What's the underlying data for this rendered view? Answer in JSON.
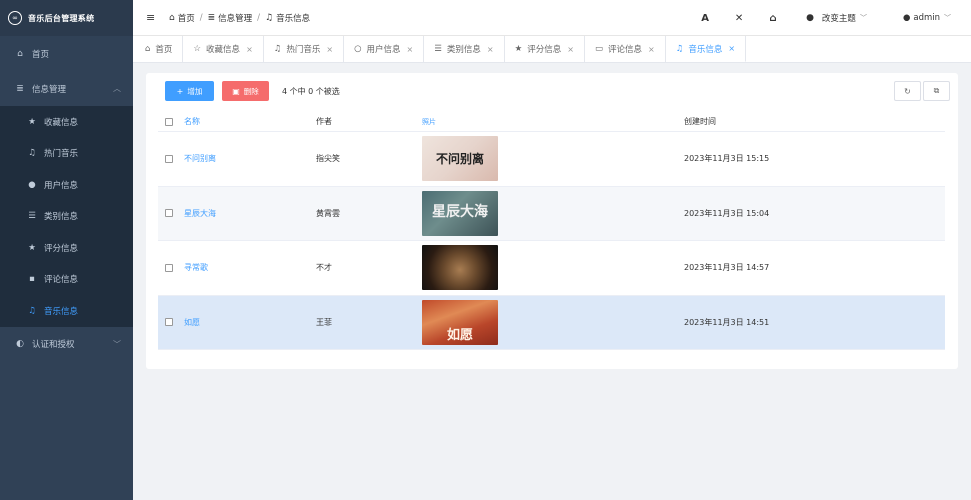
{
  "app": {
    "title": "音乐后台管理系统",
    "logo_icon": "∞"
  },
  "sidebar": {
    "home": {
      "label": "首页",
      "icon": "home-icon"
    },
    "info_mgmt": {
      "label": "信息管理",
      "icon": "database-icon"
    },
    "sub_items": [
      {
        "label": "收藏信息",
        "icon": "star-icon"
      },
      {
        "label": "热门音乐",
        "icon": "music-icon"
      },
      {
        "label": "用户信息",
        "icon": "user-icon"
      },
      {
        "label": "类别信息",
        "icon": "list-icon"
      },
      {
        "label": "评分信息",
        "icon": "star-icon"
      },
      {
        "label": "评论信息",
        "icon": "comments-icon"
      },
      {
        "label": "音乐信息",
        "icon": "music-icon",
        "active": true
      }
    ],
    "auth": {
      "label": "认证和授权",
      "icon": "shield-icon"
    }
  },
  "header": {
    "breadcrumb": [
      "首页",
      "信息管理",
      "音乐信息"
    ],
    "theme_label": "改变主题",
    "user_label": "admin"
  },
  "tabs": [
    {
      "label": "首页",
      "closable": false
    },
    {
      "label": "收藏信息",
      "closable": true
    },
    {
      "label": "热门音乐",
      "closable": true
    },
    {
      "label": "用户信息",
      "closable": true
    },
    {
      "label": "类别信息",
      "closable": true
    },
    {
      "label": "评分信息",
      "closable": true
    },
    {
      "label": "评论信息",
      "closable": true
    },
    {
      "label": "音乐信息",
      "closable": true,
      "active": true
    }
  ],
  "toolbar": {
    "add_label": "增加",
    "delete_label": "删除",
    "selection_info": "4 个中 0 个被选"
  },
  "table": {
    "columns": [
      "名称",
      "作者",
      "照片",
      "创建时间"
    ],
    "rows": [
      {
        "name": "不问别离",
        "author": "指尖笑",
        "thumb_text": "不问别离",
        "created": "2023年11月3日 15:15"
      },
      {
        "name": "星辰大海",
        "author": "黄霄雲",
        "thumb_text": "星辰大海",
        "created": "2023年11月3日 15:04"
      },
      {
        "name": "寻常歌",
        "author": "不才",
        "thumb_text": "",
        "created": "2023年11月3日 14:57"
      },
      {
        "name": "如愿",
        "author": "王菲",
        "thumb_text": "如愿",
        "created": "2023年11月3日 14:51"
      }
    ]
  },
  "colors": {
    "sidebar_bg": "#304156",
    "accent": "#409eff",
    "danger": "#f56c6c",
    "selected_row": "#dce8f8"
  }
}
